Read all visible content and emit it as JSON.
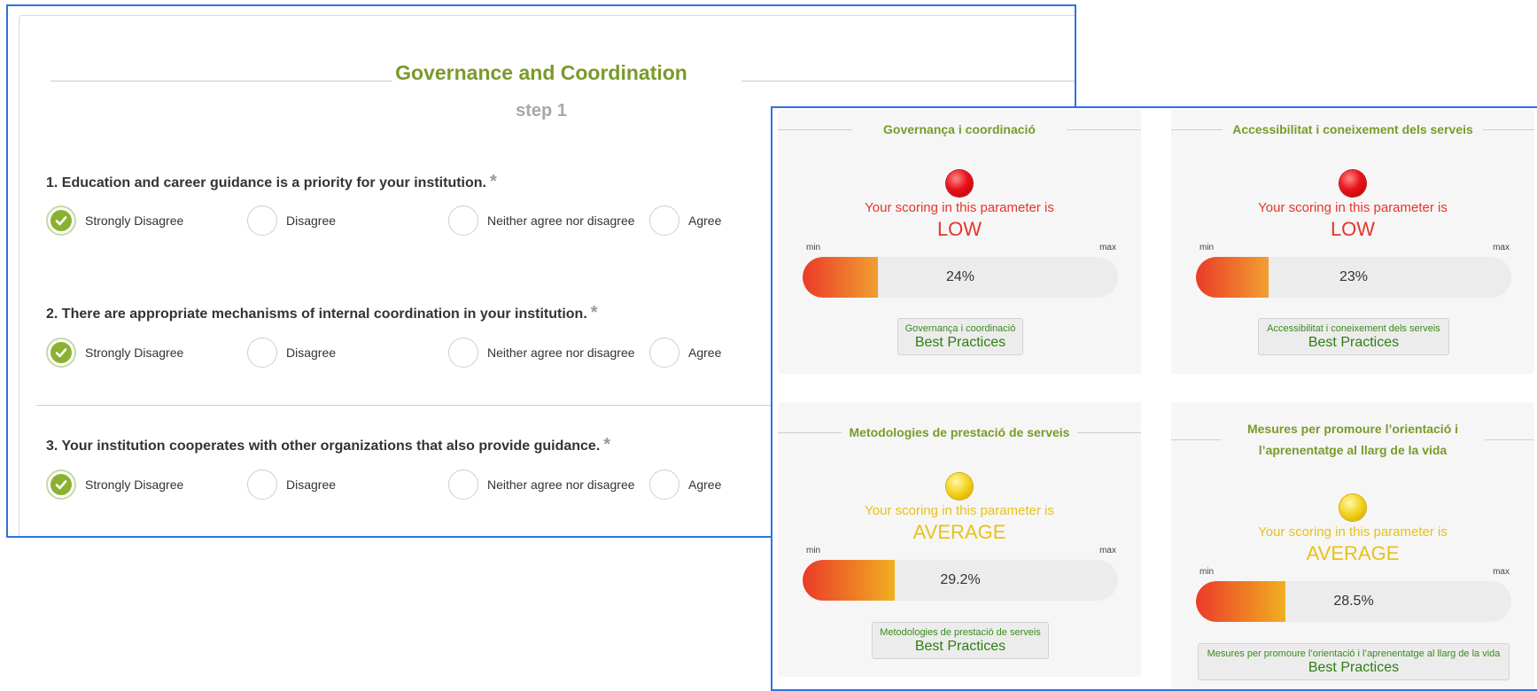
{
  "survey": {
    "title": "Governance and Coordination",
    "step": "step 1",
    "required_mark": "*",
    "options": [
      "Strongly Disagree",
      "Disagree",
      "Neither agree nor disagree",
      "Agree"
    ],
    "questions": [
      {
        "text": "1. Education and career guidance is a priority for your institution.",
        "selected": "Strongly Disagree"
      },
      {
        "text": "2. There are appropriate mechanisms of internal coordination in your institution.",
        "selected": "Strongly Disagree"
      },
      {
        "text": "3. Your institution cooperates with other organizations that also provide guidance.",
        "selected": "Strongly Disagree"
      }
    ]
  },
  "results": {
    "colors": {
      "low": "#e8342b",
      "average": "#e6c21a",
      "accent": "#7a9a2a"
    },
    "min_label": "min",
    "max_label": "max",
    "score_prefix": "Your scoring in this parameter is",
    "best_practices": "Best Practices",
    "cards": [
      {
        "title": "Governança i coordinació",
        "level": "LOW",
        "status": "red",
        "percent_label": "24%",
        "percent": 24,
        "bp_subtitle": "Governança i coordinació"
      },
      {
        "title": "Accessibilitat i coneixement dels serveis",
        "level": "LOW",
        "status": "red",
        "percent_label": "23%",
        "percent": 23,
        "bp_subtitle": "Accessibilitat i coneixement dels serveis"
      },
      {
        "title": "Metodologies de prestació de serveis",
        "level": "AVERAGE",
        "status": "yellow",
        "percent_label": "29.2%",
        "percent": 29.2,
        "bp_subtitle": "Metodologies de prestació de serveis"
      },
      {
        "title": "Mesures per promoure l’orientació i l’aprenentatge al llarg de la vida",
        "level": "AVERAGE",
        "status": "yellow",
        "percent_label": "28.5%",
        "percent": 28.5,
        "bp_subtitle": "Mesures per promoure l’orientació i l’aprenentatge al llarg de la vida"
      }
    ]
  }
}
